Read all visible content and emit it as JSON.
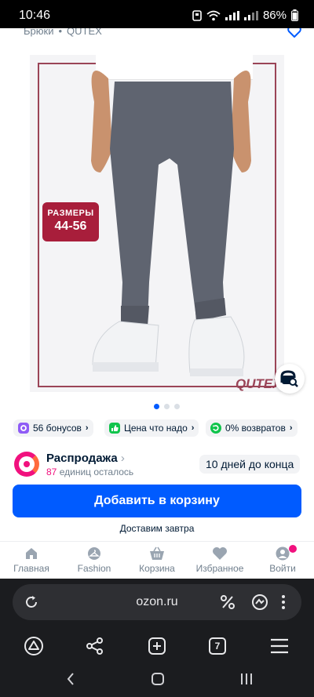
{
  "status_bar": {
    "time": "10:46",
    "battery": "86%"
  },
  "breadcrumb": {
    "category": "Брюки",
    "brand": "QUTEX"
  },
  "product_image": {
    "badge_line1": "РАЗМЕРЫ",
    "badge_line2": "44-56",
    "brand_mark": "QUTEX",
    "slide_count": 3,
    "active_slide": 1
  },
  "chips": [
    {
      "label": "56 бонусов",
      "icon": "bonus-icon",
      "color": "#8f5cf6"
    },
    {
      "label": "Цена что надо",
      "icon": "thumbs-up-icon",
      "color": "#10c44c"
    },
    {
      "label": "0% возвратов",
      "icon": "return-icon",
      "color": "#10c44c"
    }
  ],
  "sale": {
    "title": "Распродажа",
    "remaining_count": "87",
    "remaining_text": "единиц осталось",
    "days_left": "10 дней до конца"
  },
  "cart_button": {
    "label": "Добавить в корзину"
  },
  "delivery": {
    "text": "Доставим завтра"
  },
  "bottom_nav": [
    {
      "label": "Главная",
      "icon": "home-icon"
    },
    {
      "label": "Fashion",
      "icon": "hanger-icon"
    },
    {
      "label": "Корзина",
      "icon": "basket-icon"
    },
    {
      "label": "Избранное",
      "icon": "heart-icon"
    },
    {
      "label": "Войти",
      "icon": "user-icon"
    }
  ],
  "browser": {
    "url": "ozon.ru",
    "tab_count": "7"
  },
  "colors": {
    "brand_blue": "#005bff",
    "sale_pink": "#f1117e"
  }
}
